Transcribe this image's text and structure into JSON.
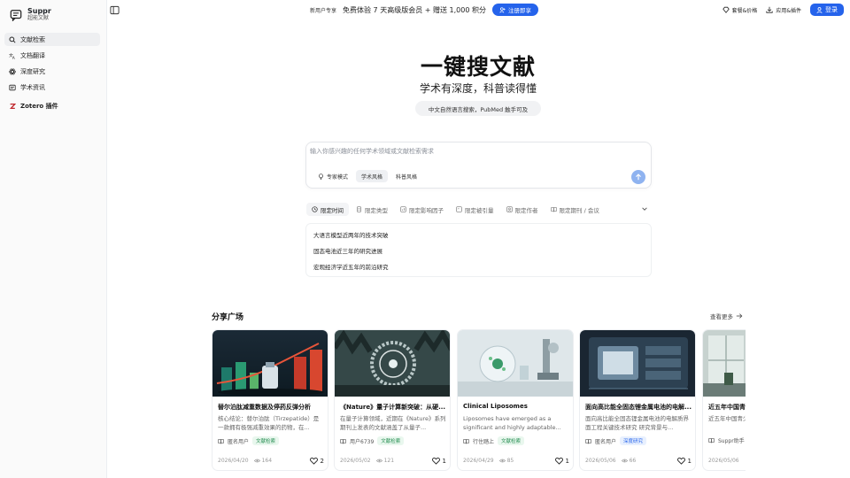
{
  "brand": {
    "name": "Suppr",
    "subtitle": "超能文献",
    "icon": "chat-logo-icon"
  },
  "sidebar": {
    "items": [
      {
        "label": "文献检索",
        "icon": "search-icon",
        "active": true
      },
      {
        "label": "文档翻译",
        "icon": "translate-icon",
        "active": false
      },
      {
        "label": "深度研究",
        "icon": "atom-icon",
        "active": false
      },
      {
        "label": "学术资讯",
        "icon": "news-icon",
        "active": false
      },
      {
        "label": "Zotero 插件",
        "icon": "zotero-icon",
        "active": false
      }
    ]
  },
  "topbar": {
    "promo_tag": "新用户专享",
    "promo_text": "免费体验 7 天高级版会员 + 赠送 1,000 积分",
    "promo_button": "注册即享",
    "pricing": "套餐&价格",
    "apps": "应用&插件",
    "login": "登录"
  },
  "hero": {
    "title": "一键搜文献",
    "subtitle": "学术有深度，科普读得懂",
    "pill": "中文自然语言搜索，PubMed 触手可及"
  },
  "search": {
    "placeholder": "输入你感兴趣的任何学术领域或文献检索需求",
    "modes": [
      "专家模式",
      "学术风格",
      "科普风格"
    ],
    "active_mode": "学术风格"
  },
  "filters": [
    "限定时间",
    "限定类型",
    "限定影响因子",
    "限定被引量",
    "限定作者",
    "限定期刊 / 会议"
  ],
  "suggestions": [
    "大语言模型近两年的技术突破",
    "固态电池近三年的研究进展",
    "宏观经济学近五年的前沿研究"
  ],
  "share": {
    "title": "分享广场",
    "more": "查看更多",
    "cards": [
      {
        "title": "替尔泊肽减重数据及停药反弹分析",
        "summary": "核心结论：替尔泊肽（Tirzepatide）是一款拥有极强减重效果的药物，在...",
        "author": "匿名用户",
        "tag": "文献检索",
        "tag_color": "green",
        "date": "2026/04/20",
        "views": "164",
        "likes": "2"
      },
      {
        "title": "《Nature》量子计算新突破：从硬...",
        "summary": "在量子计算领域，近期在《Nature》系列期刊上发表的文献涵盖了从量子...",
        "author": "用户6739",
        "tag": "文献检索",
        "tag_color": "green",
        "date": "2026/05/02",
        "views": "121",
        "likes": "1"
      },
      {
        "title": "Clinical Liposomes",
        "summary": "Liposomes have emerged as a significant and highly adaptable...",
        "author": "行住踏上",
        "tag": "文献检索",
        "tag_color": "green",
        "date": "2026/04/29",
        "views": "85",
        "likes": "1"
      },
      {
        "title": "面向高比能全固态锂金属电池的电解...",
        "summary": "面向高比能全固态锂金属电池的电解质界面工程关键技术研究 研究背景与...",
        "author": "匿名用户",
        "tag": "深度研究",
        "tag_color": "blue",
        "date": "2026/05/06",
        "views": "66",
        "likes": "1"
      },
      {
        "title": "近五年中国青",
        "summary": "近五年中国青少年心理健康学研究综述",
        "author": "Suppr助手",
        "tag": "",
        "tag_color": "green",
        "date": "2026/05/06",
        "views": "",
        "likes": ""
      }
    ]
  }
}
